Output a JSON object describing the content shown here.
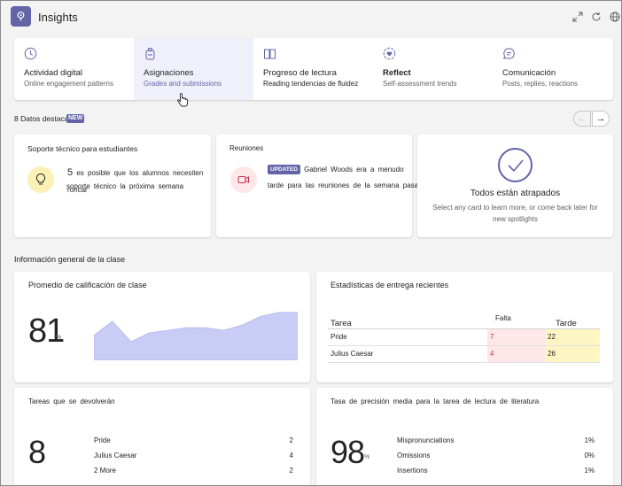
{
  "header": {
    "title": "Insights",
    "colors": {
      "accent": "#6264a7"
    }
  },
  "tabs": [
    {
      "label": "Actividad digital",
      "sub": "Online engagement patterns",
      "icon": "clock-icon"
    },
    {
      "label": "Asignaciones",
      "sub": "Grades and submissions",
      "icon": "assignment-icon"
    },
    {
      "label": "Progreso de lectura",
      "sub": "Reading tendencias de fluidez",
      "icon": "book-icon"
    },
    {
      "label": "Reflect",
      "sub": "Self-assessment trends",
      "icon": "heart-icon"
    },
    {
      "label": "Comunicación",
      "sub": "Posts, replies, reactions",
      "icon": "chat-icon"
    }
  ],
  "spotlights": {
    "title": "8 Datos destacados",
    "badge": "NEW",
    "prev": "←",
    "next": "→",
    "support": {
      "title": "Soporte técnico para estudiantes",
      "number": "5",
      "text_a": "es posible que los alumnos necesiten ",
      "text_b": "roncar",
      "text_c": "soporte técnico la próxima semana"
    },
    "meetings": {
      "title": "Reuniones",
      "badge": "UPDATED",
      "text_a": "Gabriel Woods era a menudo",
      "text_b": "tarde para las reuniones de la semana pasada"
    },
    "caught_up": {
      "title": "Todos están atrapados",
      "subtitle": "Select any card to learn more, or come back later for new spotlights"
    }
  },
  "overview": {
    "title": "Información general de la clase",
    "grade": {
      "title": "Promedio de calificación de clase",
      "value": "81",
      "unit": "%",
      "trend": [
        0.82,
        0.93,
        0.77,
        0.84,
        0.86,
        0.88,
        0.88,
        0.86,
        0.9,
        0.97,
        1.0,
        1.0
      ]
    },
    "submissions": {
      "title": "Estadísticas de entrega recientes",
      "col_task": "Tarea",
      "col_missing": "Falta",
      "col_late": "Tarde",
      "rows": [
        {
          "task": "Pride",
          "missing": "7",
          "late": "22"
        },
        {
          "task": "Julius Caesar",
          "missing": "4",
          "late": "26"
        }
      ]
    },
    "to_return": {
      "title": "Tareas que se devolverán",
      "value": "8",
      "items": [
        {
          "name": "Pride",
          "count": "2"
        },
        {
          "name": "Julius Caesar",
          "count": "4"
        },
        {
          "name": "2 More",
          "count": "2"
        }
      ]
    },
    "accuracy": {
      "title": "Tasa de precisión media para la tarea de lectura de literatura",
      "value": "98",
      "unit": "%",
      "items": [
        {
          "name": "Mispronunciations",
          "value": "1%"
        },
        {
          "name": "Omissions",
          "value": "0%"
        },
        {
          "name": "Insertions",
          "value": "1%"
        }
      ]
    }
  }
}
